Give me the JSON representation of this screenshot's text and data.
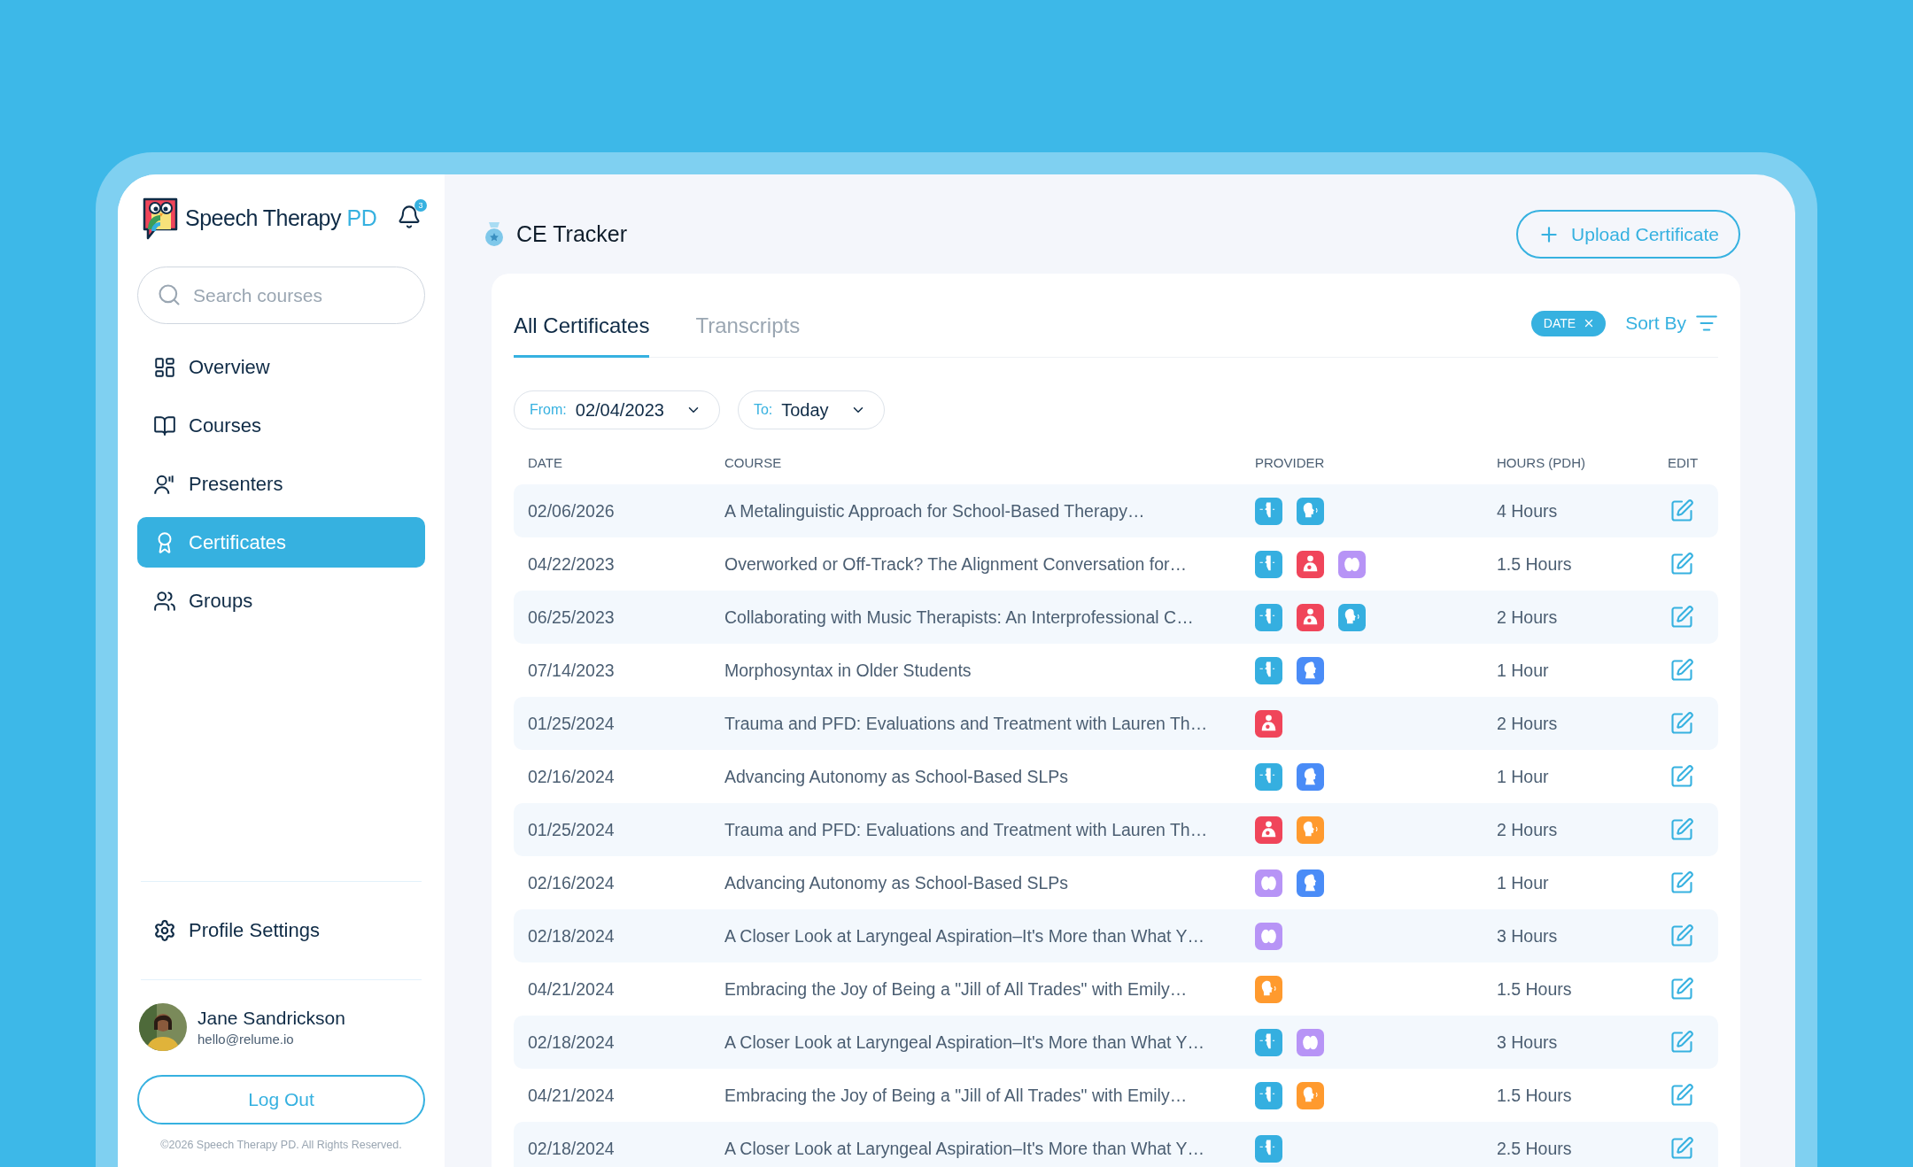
{
  "sidebar": {
    "brand": {
      "name": "Speech Therapy",
      "suffix": "PD"
    },
    "notification_count": "3",
    "search": {
      "placeholder": "Search courses"
    },
    "nav": [
      {
        "label": "Overview",
        "kind": "overview",
        "selected": false
      },
      {
        "label": "Courses",
        "kind": "courses",
        "selected": false
      },
      {
        "label": "Presenters",
        "kind": "presenters",
        "selected": false
      },
      {
        "label": "Certificates",
        "kind": "certificates",
        "selected": true
      },
      {
        "label": "Groups",
        "kind": "groups",
        "selected": false
      }
    ],
    "settings": {
      "label": "Profile Settings"
    },
    "user": {
      "name": "Jane Sandrickson",
      "email": "hello@relume.io"
    },
    "logout": "Log Out",
    "copyright": "©2026 Speech Therapy PD. All Rights Reserved."
  },
  "header": {
    "title": "CE Tracker",
    "upload_button": "Upload Certificate"
  },
  "tabs": [
    {
      "label": "All Certificates",
      "selected": true
    },
    {
      "label": "Transcripts",
      "selected": false
    }
  ],
  "active_filter": {
    "label": "DATE"
  },
  "sort": {
    "label": "Sort By"
  },
  "date_filters": [
    {
      "label": "From:",
      "value": "02/04/2023"
    },
    {
      "label": "To:",
      "value": "Today"
    }
  ],
  "table": {
    "columns": [
      "DATE",
      "COURSE",
      "PROVIDER",
      "HOURS (PDH)",
      "EDIT"
    ],
    "rows": [
      {
        "date": "02/06/2026",
        "course": "A Metalinguistic Approach for School-Based Therapy…",
        "providers": [
          {
            "kind": "voice"
          },
          {
            "kind": "child-speech"
          }
        ],
        "hours": "4 Hours"
      },
      {
        "date": "04/22/2023",
        "course": "Overworked or Off-Track? The Alignment Conversation for…",
        "providers": [
          {
            "kind": "voice"
          },
          {
            "kind": "nursing"
          },
          {
            "kind": "brain"
          }
        ],
        "hours": "1.5 Hours"
      },
      {
        "date": "06/25/2023",
        "course": "Collaborating with Music Therapists: An Interprofessional C…",
        "providers": [
          {
            "kind": "voice"
          },
          {
            "kind": "nursing"
          },
          {
            "kind": "child-speech"
          }
        ],
        "hours": "2 Hours"
      },
      {
        "date": "07/14/2023",
        "course": "Morphosyntax in Older Students",
        "providers": [
          {
            "kind": "voice"
          },
          {
            "kind": "throat"
          }
        ],
        "hours": "1 Hour"
      },
      {
        "date": "01/25/2024",
        "course": "Trauma and PFD: Evaluations and Treatment with Lauren Th…",
        "providers": [
          {
            "kind": "nursing"
          }
        ],
        "hours": "2 Hours"
      },
      {
        "date": "02/16/2024",
        "course": "Advancing Autonomy as School-Based SLPs",
        "providers": [
          {
            "kind": "voice"
          },
          {
            "kind": "throat"
          }
        ],
        "hours": "1 Hour"
      },
      {
        "date": "01/25/2024",
        "course": "Trauma and PFD: Evaluations and Treatment with Lauren Th…",
        "providers": [
          {
            "kind": "nursing"
          },
          {
            "kind": "adult-speech"
          }
        ],
        "hours": "2 Hours"
      },
      {
        "date": "02/16/2024",
        "course": "Advancing Autonomy as School-Based SLPs",
        "providers": [
          {
            "kind": "brain"
          },
          {
            "kind": "throat"
          }
        ],
        "hours": "1 Hour"
      },
      {
        "date": "02/18/2024",
        "course": "A Closer Look at Laryngeal Aspiration–It's More than What Y…",
        "providers": [
          {
            "kind": "brain"
          }
        ],
        "hours": "3 Hours"
      },
      {
        "date": "04/21/2024",
        "course": "Embracing the Joy of Being a \"Jill of All Trades\" with Emily…",
        "providers": [
          {
            "kind": "adult-speech"
          }
        ],
        "hours": "1.5 Hours"
      },
      {
        "date": "02/18/2024",
        "course": "A Closer Look at Laryngeal Aspiration–It's More than What Y…",
        "providers": [
          {
            "kind": "voice"
          },
          {
            "kind": "brain"
          }
        ],
        "hours": "3 Hours"
      },
      {
        "date": "04/21/2024",
        "course": "Embracing the Joy of Being a \"Jill of All Trades\" with Emily…",
        "providers": [
          {
            "kind": "voice"
          },
          {
            "kind": "adult-speech"
          }
        ],
        "hours": "1.5 Hours"
      },
      {
        "date": "02/18/2024",
        "course": "A Closer Look at Laryngeal Aspiration–It's More than What Y…",
        "providers": [
          {
            "kind": "voice"
          }
        ],
        "hours": "2.5 Hours"
      }
    ]
  }
}
